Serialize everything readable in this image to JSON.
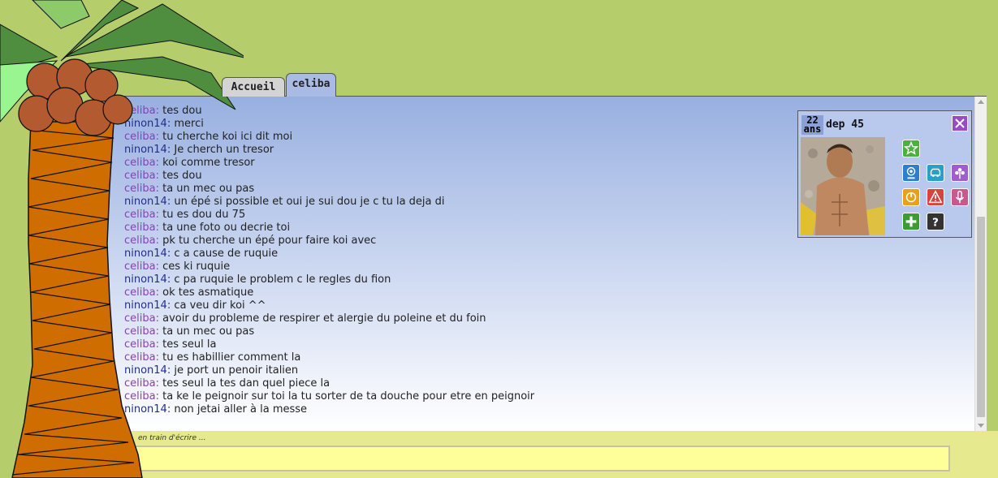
{
  "tabs": [
    {
      "label": "Accueil",
      "active": false
    },
    {
      "label": "celiba",
      "active": true
    }
  ],
  "nicks": {
    "celiba": "celiba:",
    "ninon": "ninon14:"
  },
  "messages": [
    {
      "nick": "celiba",
      "text": "tes dou"
    },
    {
      "nick": "ninon",
      "text": "merci"
    },
    {
      "nick": "celiba",
      "text": "tu cherche koi ici dit moi"
    },
    {
      "nick": "ninon",
      "text": "Je cherch un tresor"
    },
    {
      "nick": "celiba",
      "text": "koi comme tresor"
    },
    {
      "nick": "celiba",
      "text": "tes dou"
    },
    {
      "nick": "celiba",
      "text": "ta un mec ou pas"
    },
    {
      "nick": "ninon",
      "text": "un épé si possible et oui je sui dou je c tu la deja di"
    },
    {
      "nick": "celiba",
      "text": "tu es dou du 75"
    },
    {
      "nick": "celiba",
      "text": "ta une foto ou decrie toi"
    },
    {
      "nick": "celiba",
      "text": "pk tu cherche un épé pour faire koi avec"
    },
    {
      "nick": "ninon",
      "text": "c a cause de ruquie"
    },
    {
      "nick": "celiba",
      "text": "ces ki ruquie"
    },
    {
      "nick": "ninon",
      "text": "c pa ruquie le problem c le regles du fion"
    },
    {
      "nick": "celiba",
      "text": "ok tes asmatique"
    },
    {
      "nick": "ninon",
      "text": "ca veu dir koi ^^"
    },
    {
      "nick": "celiba",
      "text": "avoir du probleme de respirer et alergie du poleine et du foin"
    },
    {
      "nick": "celiba",
      "text": "ta un mec ou pas"
    },
    {
      "nick": "celiba",
      "text": "tes seul la"
    },
    {
      "nick": "celiba",
      "text": "tu es habillier comment la"
    },
    {
      "nick": "ninon",
      "text": "je port un penoir italien"
    },
    {
      "nick": "celiba",
      "text": "tes seul la tes dan quel piece la"
    },
    {
      "nick": "celiba",
      "text": "ta ke le peignoir sur toi la tu sorter de ta douche pour etre en peignoir"
    },
    {
      "nick": "ninon",
      "text": "non jetai aller à la messe"
    }
  ],
  "profile": {
    "age_value": "22",
    "age_unit": "ans",
    "dep": "dep 45",
    "buttons": [
      {
        "icon": "star-icon",
        "name": "favorite-button",
        "color": "#4caf3e"
      },
      {
        "icon": "webcam-icon",
        "name": "webcam-button",
        "color": "#2c7fd0"
      },
      {
        "icon": "car-icon",
        "name": "car-button",
        "color": "#2aa0c8"
      },
      {
        "icon": "flower-icon",
        "name": "flower-button",
        "color": "#a15ccf"
      },
      {
        "icon": "power-icon",
        "name": "ignore-button",
        "color": "#e8a21a"
      },
      {
        "icon": "warning-icon",
        "name": "report-button",
        "color": "#d8433e"
      },
      {
        "icon": "microphone-icon",
        "name": "voice-button",
        "color": "#c8588e"
      },
      {
        "icon": "plus-icon",
        "name": "add-friend-button",
        "color": "#3c9c34"
      },
      {
        "icon": "help-icon",
        "name": "help-button",
        "color": "#333333"
      }
    ]
  },
  "typing_status": "en train d'écrire ...",
  "input": {
    "value": "",
    "placeholder": ""
  }
}
